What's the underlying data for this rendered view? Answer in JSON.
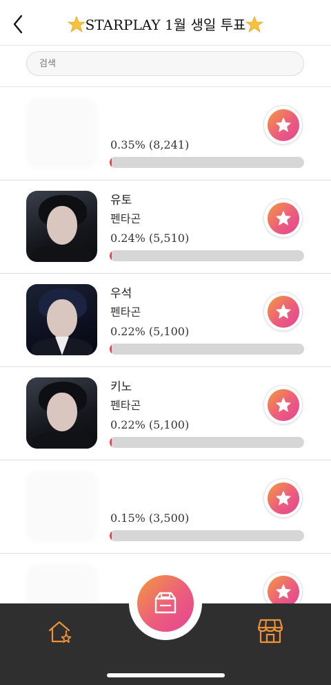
{
  "header": {
    "title": "STARPLAY 1월 생일 투표",
    "left_emoji_icon": "star-emoji-icon",
    "right_emoji_icon": "star-emoji-icon"
  },
  "search": {
    "placeholder": "검색"
  },
  "list": {
    "items": [
      {
        "name": "",
        "group": "",
        "percent_text": "0.35% (8,241)",
        "percent": 0.35,
        "votes": 8241,
        "photo": "blurred"
      },
      {
        "name": "유토",
        "group": "펜타곤",
        "percent_text": "0.24% (5,510)",
        "percent": 0.24,
        "votes": 5510,
        "photo": "portrait"
      },
      {
        "name": "우석",
        "group": "펜타곤",
        "percent_text": "0.22% (5,100)",
        "percent": 0.22,
        "votes": 5100,
        "photo": "portrait"
      },
      {
        "name": "키노",
        "group": "펜타곤",
        "percent_text": "0.22% (5,100)",
        "percent": 0.22,
        "votes": 5100,
        "photo": "portrait"
      },
      {
        "name": "",
        "group": "",
        "percent_text": "0.15% (3,500)",
        "percent": 0.15,
        "votes": 3500,
        "photo": "blurred"
      },
      {
        "name": "",
        "group": "",
        "percent_text": "",
        "photo": "blurred"
      }
    ]
  },
  "tabbar": {
    "home_icon": "home-star-icon",
    "center_icon": "ballot-box-icon",
    "store_icon": "store-icon"
  },
  "colors": {
    "accent_start": "#f29a3c",
    "accent_end": "#e34594",
    "bar_track": "#d6d6d6",
    "bar_fill": "#e8424d",
    "tabbar_bg": "#2f2f2f",
    "tab_icon": "#f0923a"
  }
}
